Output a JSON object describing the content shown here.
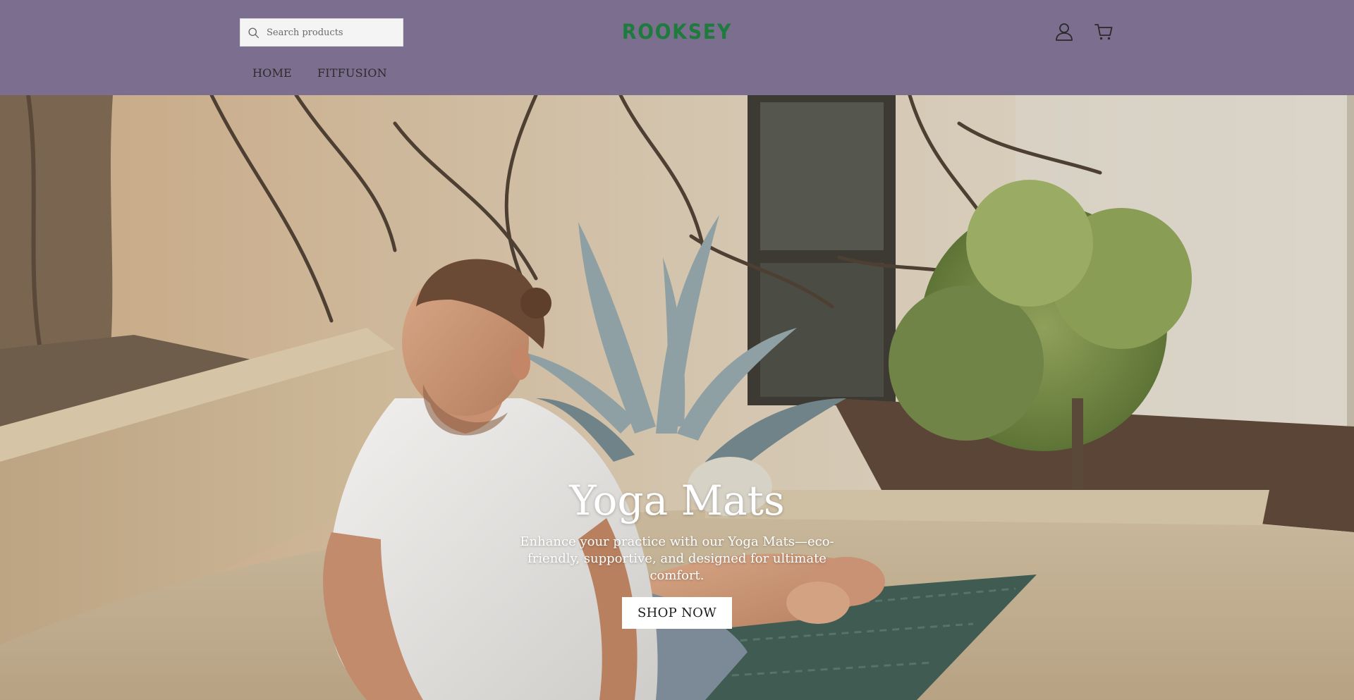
{
  "header": {
    "background_color": "#7b6e8e",
    "search": {
      "placeholder": "Search products",
      "value": ""
    },
    "logo": {
      "text": "ROOKSEY",
      "color": "#1f7a3d"
    },
    "icons": {
      "search": "search-icon",
      "account": "user-icon",
      "cart": "cart-icon"
    }
  },
  "nav": {
    "items": [
      {
        "label": "HOME"
      },
      {
        "label": "FITFUSION"
      }
    ]
  },
  "hero": {
    "title": "Yoga Mats",
    "subtitle": "Enhance your practice with our Yoga Mats—eco-friendly, supportive, and designed for ultimate comfort.",
    "button_label": "SHOP NOW",
    "image": "hero-photo"
  }
}
